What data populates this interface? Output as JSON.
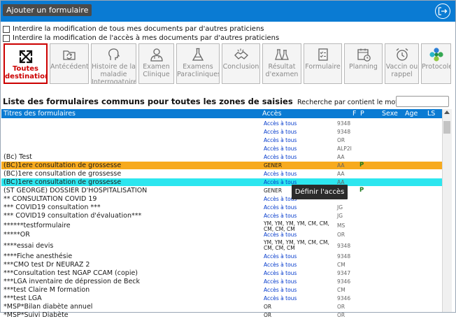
{
  "toolbar": {
    "add_button": "Ajouter un formulaire"
  },
  "options": [
    {
      "label": "Interdire la modification de tous mes documents par d'autres praticiens",
      "checked": false
    },
    {
      "label": "Interdire la modification de l'accès à mes documents par d'autres praticiens",
      "checked": false
    }
  ],
  "tiles": [
    {
      "label": "Toutes destinations",
      "icon": "arrows-expand-icon",
      "active": true
    },
    {
      "label": "Antécédent",
      "icon": "folder-refresh-icon"
    },
    {
      "label": "Histoire de la maladie Interrogatoire",
      "icon": "head-profile-icon"
    },
    {
      "label": "Examen Clinique",
      "icon": "doctor-icon"
    },
    {
      "label": "Examens Paracliniques",
      "icon": "flask-icon"
    },
    {
      "label": "Conclusion",
      "icon": "handshake-icon"
    },
    {
      "label": "Résultat d'examen",
      "icon": "flasks-icon"
    },
    {
      "label": "Formulaire",
      "icon": "checklist-icon"
    },
    {
      "label": "Planning",
      "icon": "calendar-clock-icon"
    },
    {
      "label": "Vaccin ou rappel",
      "icon": "alarm-clock-icon"
    },
    {
      "label": "Protocole",
      "icon": "protocol-cross-icon"
    }
  ],
  "list": {
    "title": "Liste des formulaires communs pour toutes les zones de saisies",
    "search_label": "Recherche par contient le mot :",
    "search_value": ""
  },
  "columns": {
    "title": "Titres des formulaires",
    "access": "Accès",
    "f": "F",
    "p": "P",
    "sexe": "Sexe",
    "age": "Age",
    "ls": "LS"
  },
  "rows": [
    {
      "title": "",
      "access": "Accès à tous",
      "code": "9348",
      "p": ""
    },
    {
      "title": "",
      "access": "Accès à tous",
      "code": "9348",
      "p": ""
    },
    {
      "title": "",
      "access": "Accès à tous",
      "code": "OR",
      "p": ""
    },
    {
      "title": "",
      "access": "Accès à tous",
      "code": "ALP2I",
      "p": ""
    },
    {
      "title": "(Bc) Test",
      "access": "Accès à tous",
      "code": "AA",
      "p": ""
    },
    {
      "title": "(BC)1ere consultation de grossesse",
      "access": "GENER",
      "code": "AA",
      "p": "P",
      "hl": "orange"
    },
    {
      "title": "(BC)1ere consultation de grossesse",
      "access": "Accès à tous",
      "code": "AA",
      "p": ""
    },
    {
      "title": "(BC)1ere consultation de grossesse",
      "access": "Accès à tous",
      "code": "AA",
      "p": "",
      "hl": "cyan"
    },
    {
      "title": "(ST GEORGE) DOSSIER D'HOSPITALISATION",
      "access": "GENER",
      "code": "",
      "p": "P"
    },
    {
      "title": "** CONSULTATION COVID 19",
      "access": "Accès à tous",
      "code": "",
      "p": ""
    },
    {
      "title": "*** COVID19 consultation ***",
      "access": "Accès à tous",
      "code": "JG",
      "p": ""
    },
    {
      "title": "*** COVID19 consultation d'évaluation***",
      "access": "Accès à tous",
      "code": "JG",
      "p": ""
    },
    {
      "title": "******testformulaire",
      "access": "YM, YM, YM, YM, CM, CM, CM, CM, CM",
      "code": "MS",
      "p": ""
    },
    {
      "title": "*****OR",
      "access": "Accès à tous",
      "code": "OR",
      "p": ""
    },
    {
      "title": "****essai devis",
      "access": "YM, YM, YM, YM, CM, CM, CM, CM, CM",
      "code": "9348",
      "p": ""
    },
    {
      "title": "****Fiche anesthésie",
      "access": "Accès à tous",
      "code": "9348",
      "p": ""
    },
    {
      "title": "***CMO test Dr NEURAZ 2",
      "access": "Accès à tous",
      "code": "CM",
      "p": ""
    },
    {
      "title": "***Consultation test NGAP CCAM (copie)",
      "access": "Accès à tous",
      "code": "9347",
      "p": ""
    },
    {
      "title": "***LGA inventaire de dépression de Beck",
      "access": "Accès à tous",
      "code": "9346",
      "p": ""
    },
    {
      "title": "***test Claire M formation",
      "access": "Accès à tous",
      "code": "CM",
      "p": ""
    },
    {
      "title": "***test LGA",
      "access": "Accès à tous",
      "code": "9346",
      "p": ""
    },
    {
      "title": "*MSP*Bilan diabète annuel",
      "access": "OR",
      "code": "OR",
      "p": ""
    },
    {
      "title": "*MSP*Suivi Diabète",
      "access": "OR",
      "code": "OR",
      "p": ""
    }
  ],
  "tooltip": "Définir l'accès",
  "colors": {
    "topbar": "#0a7bd3",
    "active_tile": "#cc0000",
    "highlight_orange": "#f7aa1e",
    "highlight_cyan": "#2de6ef",
    "access_link": "#0038cc"
  }
}
